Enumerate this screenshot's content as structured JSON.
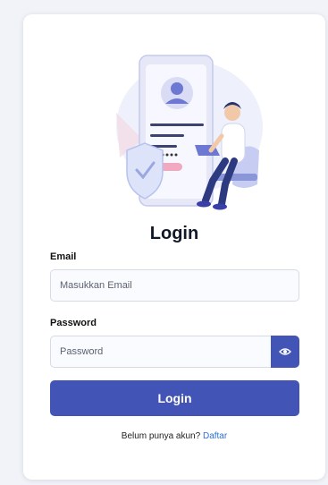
{
  "title": "Login",
  "email": {
    "label": "Email",
    "placeholder": "Masukkan Email",
    "value": ""
  },
  "password": {
    "label": "Password",
    "placeholder": "Password",
    "value": "",
    "toggle_icon": "eye-icon"
  },
  "login_button": "Login",
  "register": {
    "prompt": "Belum punya akun?",
    "link": "Daftar"
  },
  "colors": {
    "primary": "#4255b7",
    "link": "#2f6fd1",
    "background": "#f1f3f8"
  }
}
